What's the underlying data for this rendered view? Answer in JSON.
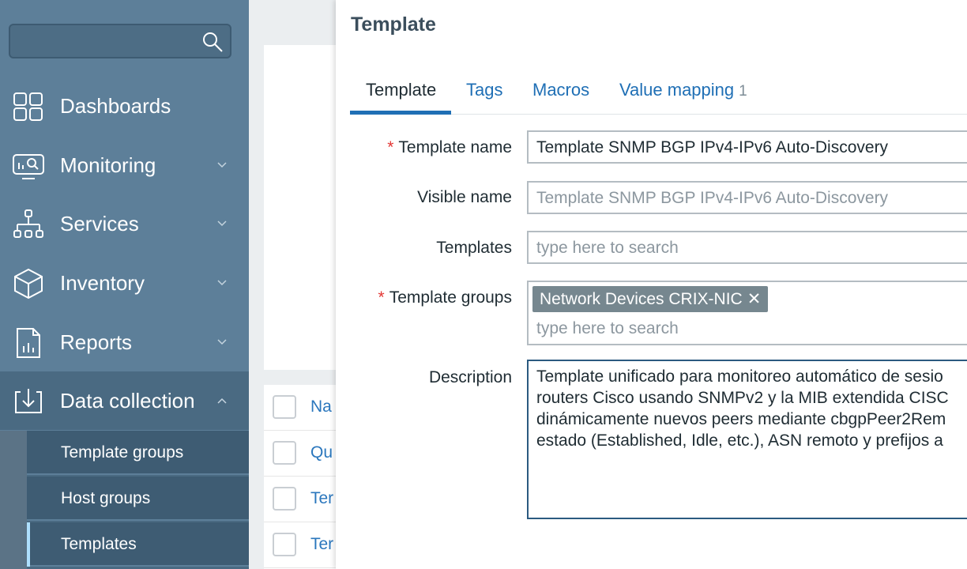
{
  "sidebar": {
    "search": {
      "placeholder": ""
    },
    "items": [
      {
        "label": "Dashboards",
        "icon": "dashboards-icon",
        "has_chevron": false
      },
      {
        "label": "Monitoring",
        "icon": "monitoring-icon",
        "has_chevron": true
      },
      {
        "label": "Services",
        "icon": "services-icon",
        "has_chevron": true
      },
      {
        "label": "Inventory",
        "icon": "inventory-icon",
        "has_chevron": true
      },
      {
        "label": "Reports",
        "icon": "reports-icon",
        "has_chevron": true
      },
      {
        "label": "Data collection",
        "icon": "data-collection-icon",
        "has_chevron": true,
        "expanded": true
      }
    ],
    "sub_items": [
      {
        "label": "Template groups"
      },
      {
        "label": "Host groups"
      },
      {
        "label": "Templates",
        "selected": true
      }
    ]
  },
  "background_table": {
    "rows": [
      "Na",
      "Qu",
      "Ter",
      "Ter"
    ]
  },
  "modal": {
    "title": "Template",
    "tabs": [
      {
        "label": "Template",
        "active": true
      },
      {
        "label": "Tags"
      },
      {
        "label": "Macros"
      },
      {
        "label": "Value mapping",
        "count": "1"
      }
    ],
    "form": {
      "template_name": {
        "label": "Template name",
        "required": true,
        "value": "Template SNMP BGP IPv4-IPv6 Auto-Discovery"
      },
      "visible_name": {
        "label": "Visible name",
        "placeholder": "Template SNMP BGP IPv4-IPv6 Auto-Discovery"
      },
      "templates": {
        "label": "Templates",
        "placeholder": "type here to search"
      },
      "template_groups": {
        "label": "Template groups",
        "required": true,
        "chip": "Network Devices CRIX-NIC",
        "chip_remove": "✕",
        "placeholder": "type here to search"
      },
      "description": {
        "label": "Description",
        "lines": [
          "Template unificado para monitoreo automático de sesio",
          "routers Cisco usando SNMPv2 y la MIB extendida CISC",
          "dinámicamente nuevos peers mediante cbgpPeer2Rem",
          "estado (Established, Idle, etc.), ASN remoto y prefijos a"
        ]
      }
    }
  },
  "colors": {
    "sidebar_bg": "#5d7f99",
    "link_blue": "#1f6fb5",
    "required_red": "#e33734"
  }
}
